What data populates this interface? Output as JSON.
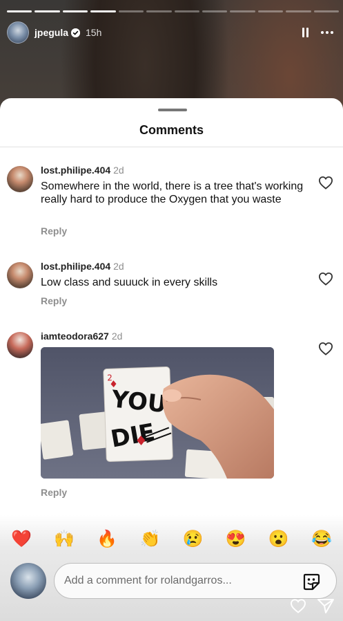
{
  "story": {
    "username": "jpegula",
    "time": "15h",
    "progress_total": 12,
    "progress_done": 4
  },
  "sheet": {
    "title": "Comments"
  },
  "comments": [
    {
      "username": "lost.philipe.404",
      "time": "2d",
      "text": "Somewhere in the world, there is a tree that's working really hard to produce the Oxygen that you waste",
      "reply": "Reply"
    },
    {
      "username": "lost.philipe.404",
      "time": "2d",
      "text": "Low class and suuuck in every skills",
      "reply": "Reply"
    },
    {
      "username": "iamteodora627",
      "time": "2d",
      "gif_text_top": "YOU",
      "gif_text_bottom": "DIE",
      "card_rank": "2",
      "reply": "Reply"
    }
  ],
  "reactions": [
    "❤️",
    "🙌",
    "🔥",
    "👏",
    "😢",
    "😍",
    "😮",
    "😂"
  ],
  "input": {
    "placeholder": "Add a comment for rolandgarros..."
  },
  "colors": {
    "heart_red": "#ed1c24",
    "secondary_text": "#8e8e8e"
  }
}
